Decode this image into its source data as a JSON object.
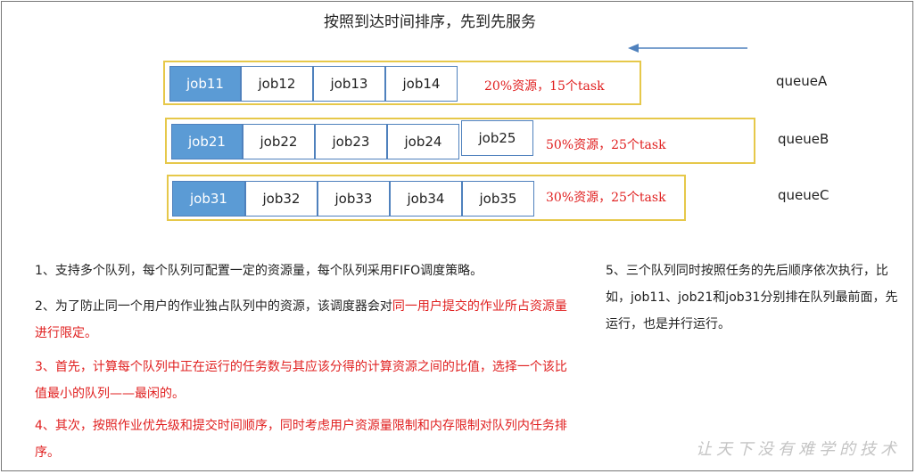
{
  "title": "按照到达时间排序，先到先服务",
  "colors": {
    "queue_border": "#e6c84a",
    "job_border": "#4f81bd",
    "job_head_fill": "#5b9bd5",
    "share_text": "#e02020",
    "arrow": "#4f81bd"
  },
  "queues": [
    {
      "name": "queueA",
      "jobs": [
        "job11",
        "job12",
        "job13",
        "job14"
      ],
      "share": "20%资源，15个task"
    },
    {
      "name": "queueB",
      "jobs": [
        "job21",
        "job22",
        "job23",
        "job24",
        "job25"
      ],
      "share": "50%资源，25个task"
    },
    {
      "name": "queueC",
      "jobs": [
        "job31",
        "job32",
        "job33",
        "job34",
        "job35"
      ],
      "share": "30%资源，25个task"
    }
  ],
  "notes": {
    "n1": "1、支持多个队列，每个队列可配置一定的资源量，每个队列采用FIFO调度策略。",
    "n2_a": "2、为了防止同一个用户的作业独占队列中的资源，该调度器会对",
    "n2_b": "同一用户提交的作业所占资源量进行限定。",
    "n3": "3、首先，计算每个队列中正在运行的任务数与其应该分得的计算资源之间的比值，选择一个该比值最小的队列——最闲的。",
    "n4": "4、其次，按照作业优先级和提交时间顺序，同时考虑用户资源量限制和内存限制对队列内任务排序。",
    "n5": "5、三个队列同时按照任务的先后顺序依次执行，比如，job11、job21和job31分别排在队列最前面，先运行，也是并行运行。"
  },
  "watermark": "让天下没有难学的技术"
}
